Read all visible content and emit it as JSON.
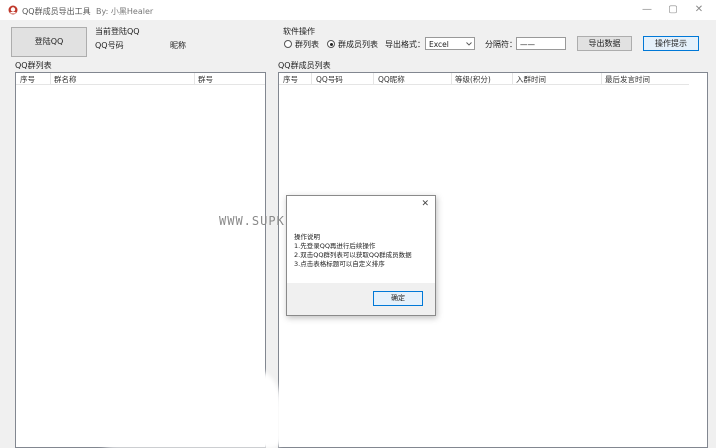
{
  "window": {
    "title": "QQ群成员导出工具",
    "author": "By: 小黑Healer",
    "controls": [
      "—",
      "▢",
      "✕"
    ]
  },
  "account": {
    "login_button": "登陆QQ",
    "current_qq_label": "当前登陆QQ",
    "qq_number_label": "QQ号码",
    "nickname_label": "昵称"
  },
  "software_ops": {
    "section_label": "软件操作",
    "radio_group_list": "群列表",
    "radio_member_list": "群成员列表",
    "selected": "群成员列表",
    "export_format_label": "导出格式：",
    "export_format_value": "Excel",
    "separator_label": "分隔符：",
    "separator_value": "——",
    "export_button": "导出数据",
    "tips_button": "操作提示"
  },
  "group_list": {
    "title": "QQ群列表",
    "columns": [
      "序号",
      "群名称",
      "群号"
    ]
  },
  "member_list": {
    "title": "QQ群成员列表",
    "columns": [
      "序号",
      "QQ号码",
      "QQ昵称",
      "等级(积分)",
      "入群时间",
      "最后发言时间"
    ]
  },
  "dialog": {
    "heading": "操作说明",
    "lines": [
      "1.先登录QQ再进行后续操作",
      "2.双击QQ群列表可以获取QQ群成员数据",
      "3.点击表格标题可以自定义排序"
    ],
    "ok_button": "确定",
    "close_glyph": "✕"
  },
  "watermark": "WWW.SUPK.COM",
  "colors": {
    "accent": "#0078d7",
    "background": "#f0f0f0",
    "panel": "#ffffff"
  }
}
